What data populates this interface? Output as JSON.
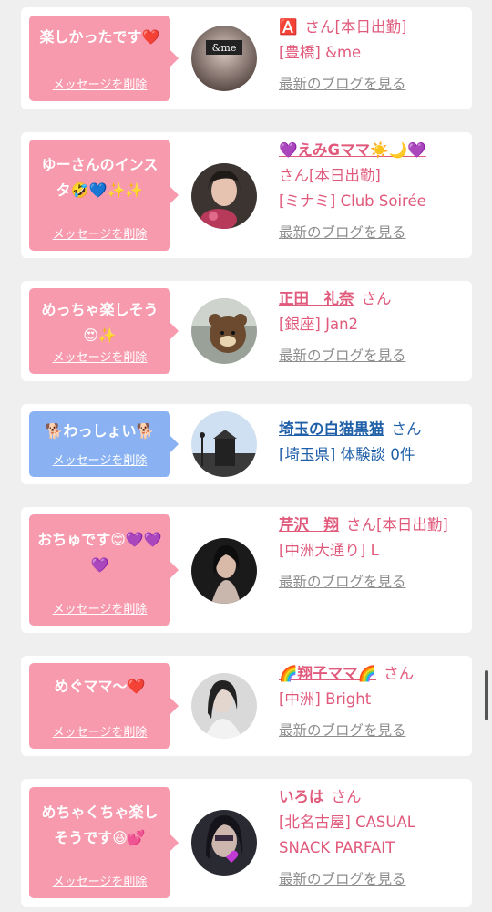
{
  "cards": [
    {
      "message": "楽しかったです❤️",
      "delete_label": "メッセージを削除",
      "name": "",
      "name_prefix": "🅰️",
      "suffix": "さん[本日出勤]",
      "store": "[豊橋] &me",
      "blog_label": "最新のブログを見る",
      "bubble_color": "pink"
    },
    {
      "message": "ゆーさんのインスタ🤣💙✨✨",
      "delete_label": "メッセージを削除",
      "name": "💜えみGママ☀️🌙💜",
      "suffix": "さん[本日出勤]",
      "store": "[ミナミ] Club Soirée",
      "blog_label": "最新のブログを見る",
      "bubble_color": "pink"
    },
    {
      "message": "めっちゃ楽しそう😍✨",
      "delete_label": "メッセージを削除",
      "name": "正田　礼奈",
      "suffix": "さん",
      "store": "[銀座] Jan2",
      "blog_label": "最新のブログを見る",
      "bubble_color": "pink"
    },
    {
      "message": "🐕わっしょい🐕",
      "delete_label": "メッセージを削除",
      "name": "埼玉の白猫黒猫",
      "suffix": "さん",
      "store": "[埼玉県] 体験談 0件",
      "blog_label": "",
      "bubble_color": "blue"
    },
    {
      "message": "おちゅです😊💜💜💜",
      "delete_label": "メッセージを削除",
      "name": "芹沢　翔",
      "suffix": "さん[本日出勤]",
      "store": "[中洲大通り] L",
      "blog_label": "最新のブログを見る",
      "bubble_color": "pink"
    },
    {
      "message": "めぐママ〜❤️",
      "delete_label": "メッセージを削除",
      "name": "🌈翔子ママ🌈",
      "suffix": "さん",
      "store": "[中洲] Bright",
      "blog_label": "最新のブログを見る",
      "bubble_color": "pink"
    },
    {
      "message": "めちゃくちゃ楽しそうです😆💕",
      "delete_label": "メッセージを削除",
      "name": "いろは",
      "suffix": "さん",
      "store": "[北名古屋] CASUAL SNACK PARFAIT",
      "blog_label": "最新のブログを見る",
      "bubble_color": "pink"
    }
  ],
  "avatar_overlay_text": "&me",
  "colors": {
    "pink_bubble": "#f79aad",
    "blue_bubble": "#8ab2f2",
    "name_pink": "#e05a7c",
    "name_blue": "#1f5fa8",
    "blog_gray": "#8d8d8d"
  }
}
